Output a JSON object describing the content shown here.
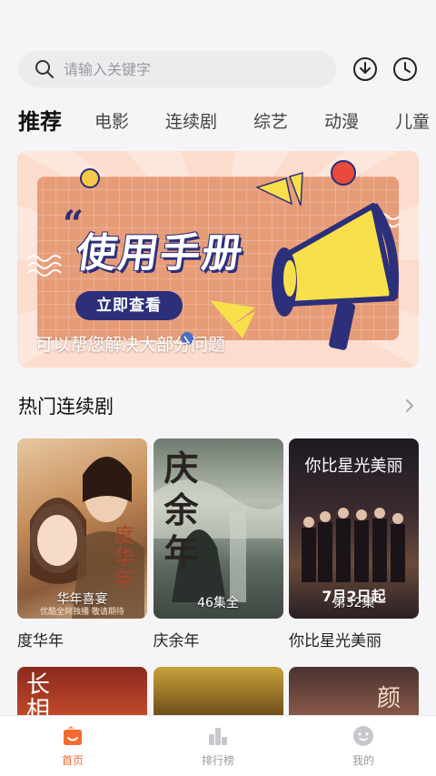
{
  "search": {
    "placeholder": "请输入关键字"
  },
  "tabs": [
    "推荐",
    "电影",
    "连续剧",
    "综艺",
    "动漫",
    "儿童"
  ],
  "banner": {
    "quote_mark": "“",
    "title": "使用手册",
    "button_label": "立即查看",
    "caption": "可以帮您解决大部分问题"
  },
  "section": {
    "title": "热门连续剧"
  },
  "cards": [
    {
      "title": "度华年",
      "badge": "华年喜宴",
      "poster_title": "度华年",
      "poster_sub": "优酷全网独播 敬请期待"
    },
    {
      "title": "庆余年",
      "badge": "46集全",
      "poster_title": "庆余年"
    },
    {
      "title": "你比星光美丽",
      "badge": "第32集",
      "poster_title": "你比星光美丽",
      "poster_date": "7月2日起"
    }
  ],
  "second_row": [
    {
      "poster_title": "长相"
    },
    {
      "poster_title": ""
    },
    {
      "poster_title": "颜"
    }
  ],
  "bottom_nav": [
    {
      "label": "首页",
      "icon": "home-icon",
      "active": true
    },
    {
      "label": "排行榜",
      "icon": "ranking-icon",
      "active": false
    },
    {
      "label": "我的",
      "icon": "profile-icon",
      "active": false
    }
  ],
  "colors": {
    "accent": "#f26a2f",
    "banner_bg": "#fcd8c8",
    "banner_board": "#e8a07c",
    "navy": "#2c2f7a"
  }
}
